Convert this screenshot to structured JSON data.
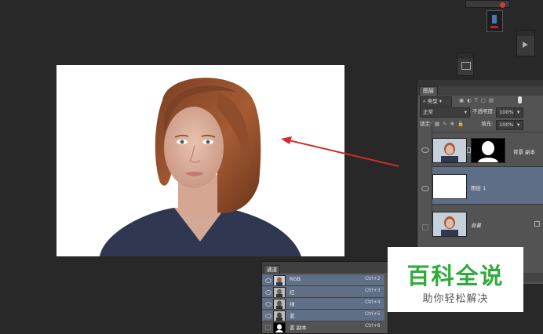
{
  "layers_panel": {
    "tab": "图层",
    "filter_label": "类型",
    "blend_mode": "正常",
    "opacity_label": "不透明度:",
    "opacity_value": "100%",
    "lock_label": "锁定:",
    "fill_label": "填充:",
    "fill_value": "100%",
    "layers": [
      {
        "name": "背景 副本",
        "visible": true,
        "selected": false,
        "has_mask": true
      },
      {
        "name": "图层 1",
        "visible": true,
        "selected": true,
        "has_mask": false
      },
      {
        "name": "背景",
        "visible": false,
        "selected": false,
        "locked": true
      }
    ]
  },
  "channels_panel": {
    "tab": "通道",
    "channels": [
      {
        "name": "RGB",
        "shortcut": "Ctrl+2",
        "visible": true
      },
      {
        "name": "红",
        "shortcut": "Ctrl+3",
        "visible": true
      },
      {
        "name": "绿",
        "shortcut": "Ctrl+4",
        "visible": true
      },
      {
        "name": "蓝",
        "shortcut": "Ctrl+5",
        "visible": true
      },
      {
        "name": "蓝 副本",
        "shortcut": "Ctrl+6",
        "visible": false
      }
    ]
  },
  "watermark": {
    "title": "百科全说",
    "subtitle": "助你轻松解决"
  },
  "colors": {
    "workspace": "#282828",
    "panel": "#535353",
    "selected_row": "#5e6e86",
    "arrow": "#d42a2a",
    "watermark_green": "#2eac3b"
  }
}
